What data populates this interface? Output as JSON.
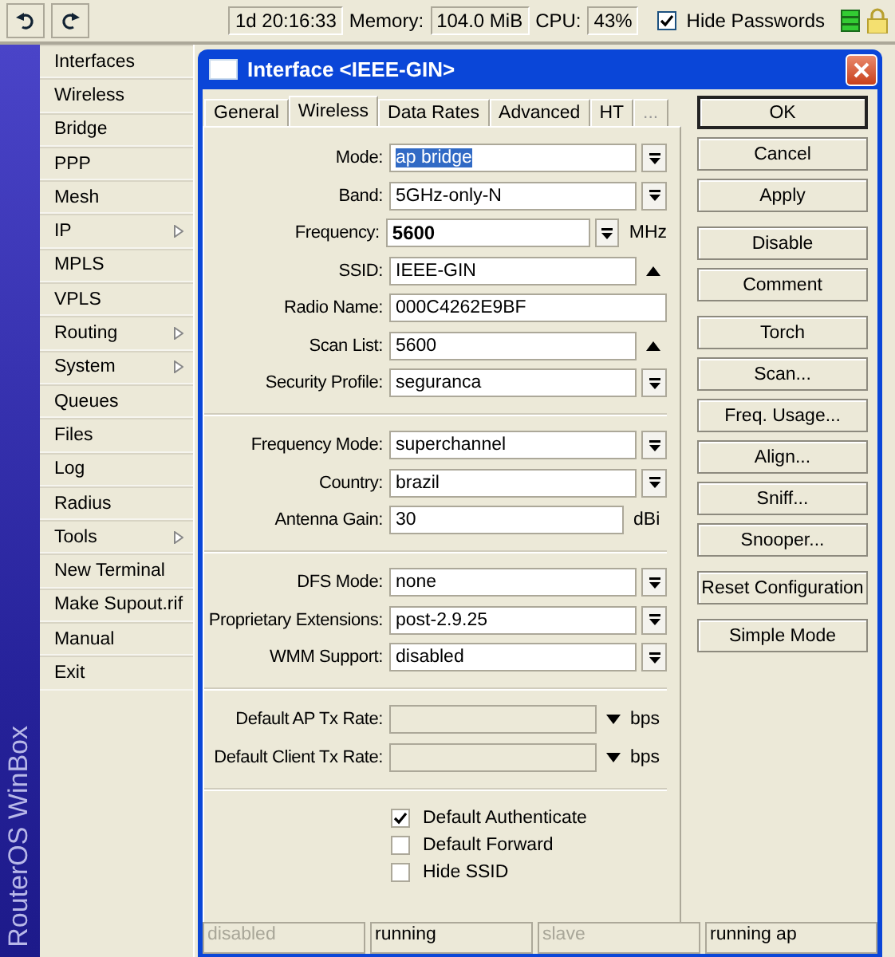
{
  "toolbar": {
    "uptime": "1d 20:16:33",
    "memory_label": "Memory:",
    "memory": "104.0 MiB",
    "cpu_label": "CPU:",
    "cpu": "43%",
    "hide_passwords": {
      "label": "Hide Passwords",
      "checked": true
    }
  },
  "sidebar": {
    "brand": "RouterOS WinBox",
    "items": [
      {
        "label": "Interfaces",
        "submenu": false
      },
      {
        "label": "Wireless",
        "submenu": false
      },
      {
        "label": "Bridge",
        "submenu": false
      },
      {
        "label": "PPP",
        "submenu": false
      },
      {
        "label": "Mesh",
        "submenu": false
      },
      {
        "label": "IP",
        "submenu": true
      },
      {
        "label": "MPLS",
        "submenu": false
      },
      {
        "label": "VPLS",
        "submenu": false
      },
      {
        "label": "Routing",
        "submenu": true
      },
      {
        "label": "System",
        "submenu": true
      },
      {
        "label": "Queues",
        "submenu": false
      },
      {
        "label": "Files",
        "submenu": false
      },
      {
        "label": "Log",
        "submenu": false
      },
      {
        "label": "Radius",
        "submenu": false
      },
      {
        "label": "Tools",
        "submenu": true
      },
      {
        "label": "New Terminal",
        "submenu": false
      },
      {
        "label": "Make Supout.rif",
        "submenu": false
      },
      {
        "label": "Manual",
        "submenu": false
      },
      {
        "label": "Exit",
        "submenu": false
      }
    ]
  },
  "window": {
    "title": "Interface <IEEE-GIN>",
    "tabs": [
      {
        "label": "General",
        "selected": false
      },
      {
        "label": "Wireless",
        "selected": true
      },
      {
        "label": "Data Rates",
        "selected": false
      },
      {
        "label": "Advanced",
        "selected": false
      },
      {
        "label": "HT",
        "selected": false
      },
      {
        "label": "...",
        "selected": false
      }
    ],
    "groups": [
      [
        {
          "label": "Mode:",
          "kind": "dropdown",
          "value": "ap bridge",
          "selected": true,
          "bold": false
        },
        {
          "label": "Band:",
          "kind": "dropdown",
          "value": "5GHz-only-N",
          "selected": false,
          "bold": false
        },
        {
          "label": "Frequency:",
          "kind": "dropdown",
          "value": "5600",
          "unit": "MHz",
          "selected": false,
          "bold": true
        },
        {
          "label": "SSID:",
          "kind": "combo",
          "value": "IEEE-GIN",
          "selected": false,
          "bold": false
        },
        {
          "label": "Radio Name:",
          "kind": "text",
          "value": "000C4262E9BF",
          "selected": false,
          "bold": false
        },
        {
          "label": "Scan List:",
          "kind": "combo",
          "value": "5600",
          "selected": false,
          "bold": false
        },
        {
          "label": "Security Profile:",
          "kind": "dropdown",
          "value": "seguranca",
          "selected": false,
          "bold": false
        }
      ],
      [
        {
          "label": "Frequency Mode:",
          "kind": "dropdown",
          "value": "superchannel",
          "selected": false,
          "bold": false
        },
        {
          "label": "Country:",
          "kind": "dropdown",
          "value": "brazil",
          "selected": false,
          "bold": false
        },
        {
          "label": "Antenna Gain:",
          "kind": "text",
          "value": "30",
          "unit": "dBi",
          "selected": false,
          "bold": false
        }
      ],
      [
        {
          "label": "DFS Mode:",
          "kind": "dropdown",
          "value": "none",
          "selected": false,
          "bold": false
        },
        {
          "label": "Proprietary Extensions:",
          "kind": "dropdown",
          "value": "post-2.9.25",
          "selected": false,
          "bold": false
        },
        {
          "label": "WMM Support:",
          "kind": "dropdown",
          "value": "disabled",
          "selected": false,
          "bold": false
        }
      ],
      [
        {
          "label": "Default AP Tx Rate:",
          "kind": "rate",
          "unit": "bps"
        },
        {
          "label": "Default Client Tx Rate:",
          "kind": "rate",
          "unit": "bps"
        }
      ]
    ],
    "checkboxes": [
      {
        "label": "Default Authenticate",
        "checked": true
      },
      {
        "label": "Default Forward",
        "checked": false
      },
      {
        "label": "Hide SSID",
        "checked": false
      }
    ],
    "buttons": [
      [
        {
          "label": "OK",
          "default": true
        },
        {
          "label": "Cancel",
          "default": false
        },
        {
          "label": "Apply",
          "default": false
        }
      ],
      [
        {
          "label": "Disable",
          "default": false
        },
        {
          "label": "Comment",
          "default": false
        }
      ],
      [
        {
          "label": "Torch",
          "default": false
        },
        {
          "label": "Scan...",
          "default": false
        },
        {
          "label": "Freq. Usage...",
          "default": false
        },
        {
          "label": "Align...",
          "default": false
        },
        {
          "label": "Sniff...",
          "default": false
        },
        {
          "label": "Snooper...",
          "default": false
        }
      ],
      [
        {
          "label": "Reset Configuration",
          "default": false
        }
      ],
      [
        {
          "label": "Simple Mode",
          "default": false
        }
      ]
    ],
    "status_bar": [
      {
        "text": "disabled",
        "active": false
      },
      {
        "text": "running",
        "active": true
      },
      {
        "text": "slave",
        "active": false
      },
      {
        "text": "running ap",
        "active": true
      }
    ]
  }
}
